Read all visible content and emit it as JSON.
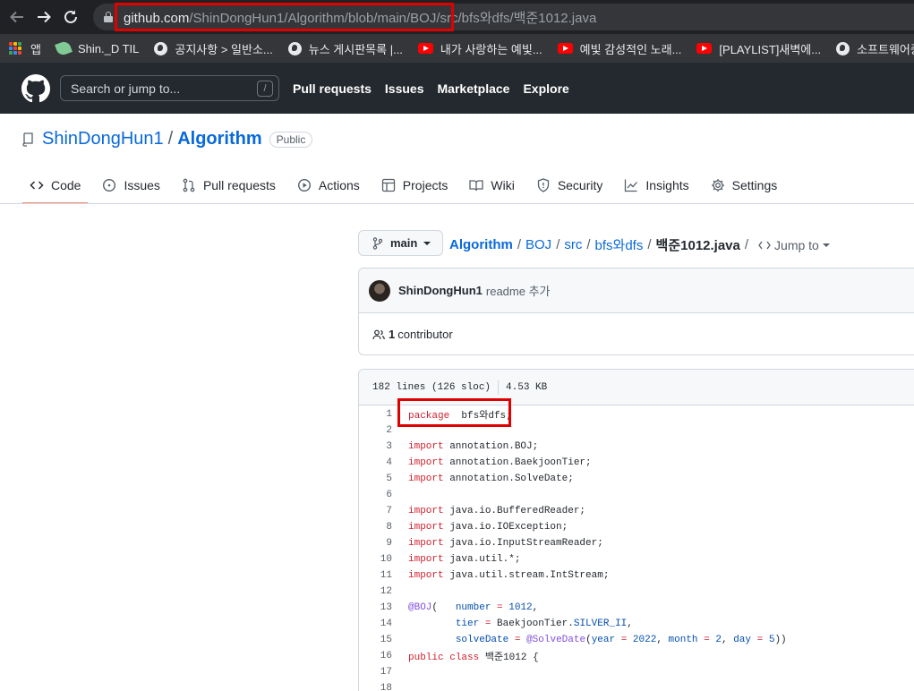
{
  "browser": {
    "url_host": "github.com",
    "url_path": "/ShinDongHun1/Algorithm/blob/main/BOJ/src/bfs와dfs/백준1012.java",
    "bookmarks": [
      {
        "label": "앱",
        "icon": "apps-grid-icon"
      },
      {
        "label": "Shin._D TIL",
        "icon": "leaf-icon"
      },
      {
        "label": "공지사항 > 일반소...",
        "icon": "globe-icon"
      },
      {
        "label": "뉴스 게시판목록 |...",
        "icon": "globe-icon"
      },
      {
        "label": "내가 사랑하는 예빛...",
        "icon": "youtube-icon"
      },
      {
        "label": "예빛 감성적인 노래...",
        "icon": "youtube-icon"
      },
      {
        "label": "[PLAYLIST]새벽에...",
        "icon": "youtube-icon"
      },
      {
        "label": "소프트웨어중심대...",
        "icon": "globe-icon"
      }
    ]
  },
  "header": {
    "search_placeholder": "Search or jump to...",
    "search_key": "/",
    "nav": [
      "Pull requests",
      "Issues",
      "Marketplace",
      "Explore"
    ]
  },
  "repo": {
    "owner": "ShinDongHun1",
    "separator": "/",
    "name": "Algorithm",
    "visibility": "Public",
    "tabs": [
      {
        "label": "Code",
        "icon": "code-icon",
        "selected": true
      },
      {
        "label": "Issues",
        "icon": "issue-icon"
      },
      {
        "label": "Pull requests",
        "icon": "pull-request-icon"
      },
      {
        "label": "Actions",
        "icon": "play-icon"
      },
      {
        "label": "Projects",
        "icon": "table-icon"
      },
      {
        "label": "Wiki",
        "icon": "book-icon"
      },
      {
        "label": "Security",
        "icon": "shield-icon"
      },
      {
        "label": "Insights",
        "icon": "graph-icon"
      },
      {
        "label": "Settings",
        "icon": "gear-icon"
      }
    ]
  },
  "file_nav": {
    "branch": "main",
    "path": [
      "Algorithm",
      "BOJ",
      "src",
      "bfs와dfs"
    ],
    "separator": "/",
    "filename": "백준1012.java",
    "jump_label": "Jump to"
  },
  "commit": {
    "author": "ShinDongHun1",
    "message": "readme 추가",
    "contributor_count": "1",
    "contributor_label": "contributor"
  },
  "file_info": {
    "lines": "182 lines (126 sloc)",
    "size": "4.53 KB"
  },
  "code_lines": [
    {
      "n": "1",
      "tokens": [
        [
          "kw",
          "package"
        ],
        [
          "",
          "  bfs와dfs;"
        ]
      ]
    },
    {
      "n": "2",
      "tokens": []
    },
    {
      "n": "3",
      "tokens": [
        [
          "kw",
          "import"
        ],
        [
          "",
          " annotation.BOJ;"
        ]
      ]
    },
    {
      "n": "4",
      "tokens": [
        [
          "kw",
          "import"
        ],
        [
          "",
          " annotation.BaekjoonTier;"
        ]
      ]
    },
    {
      "n": "5",
      "tokens": [
        [
          "kw",
          "import"
        ],
        [
          "",
          " annotation.SolveDate;"
        ]
      ]
    },
    {
      "n": "6",
      "tokens": []
    },
    {
      "n": "7",
      "tokens": [
        [
          "kw",
          "import"
        ],
        [
          "",
          " java.io.BufferedReader;"
        ]
      ]
    },
    {
      "n": "8",
      "tokens": [
        [
          "kw",
          "import"
        ],
        [
          "",
          " java.io.IOException;"
        ]
      ]
    },
    {
      "n": "9",
      "tokens": [
        [
          "kw",
          "import"
        ],
        [
          "",
          " java.io.InputStreamReader;"
        ]
      ]
    },
    {
      "n": "10",
      "tokens": [
        [
          "kw",
          "import"
        ],
        [
          "",
          " java.util.*;"
        ]
      ]
    },
    {
      "n": "11",
      "tokens": [
        [
          "kw",
          "import"
        ],
        [
          "",
          " java.util.stream.IntStream;"
        ]
      ]
    },
    {
      "n": "12",
      "tokens": []
    },
    {
      "n": "13",
      "tokens": [
        [
          "ann",
          "@BOJ"
        ],
        [
          "",
          "(   "
        ],
        [
          "const",
          "number"
        ],
        [
          "",
          " "
        ],
        [
          "kw",
          "="
        ],
        [
          "",
          " "
        ],
        [
          "const",
          "1012"
        ],
        [
          "",
          ","
        ]
      ]
    },
    {
      "n": "14",
      "tokens": [
        [
          "",
          "        "
        ],
        [
          "const",
          "tier"
        ],
        [
          "",
          " "
        ],
        [
          "kw",
          "="
        ],
        [
          "",
          " BaekjoonTier."
        ],
        [
          "const",
          "SILVER_II"
        ],
        [
          "",
          ","
        ]
      ]
    },
    {
      "n": "15",
      "tokens": [
        [
          "",
          "        "
        ],
        [
          "const",
          "solveDate"
        ],
        [
          "",
          " "
        ],
        [
          "kw",
          "="
        ],
        [
          "",
          " "
        ],
        [
          "ann",
          "@SolveDate"
        ],
        [
          "",
          "("
        ],
        [
          "const",
          "year"
        ],
        [
          "",
          " "
        ],
        [
          "kw",
          "="
        ],
        [
          "",
          " "
        ],
        [
          "const",
          "2022"
        ],
        [
          "",
          ", "
        ],
        [
          "const",
          "month"
        ],
        [
          "",
          " "
        ],
        [
          "kw",
          "="
        ],
        [
          "",
          " "
        ],
        [
          "const",
          "2"
        ],
        [
          "",
          ", "
        ],
        [
          "const",
          "day"
        ],
        [
          "",
          " "
        ],
        [
          "kw",
          "="
        ],
        [
          "",
          " "
        ],
        [
          "const",
          "5"
        ],
        [
          "",
          "))"
        ]
      ]
    },
    {
      "n": "16",
      "tokens": [
        [
          "kw",
          "public"
        ],
        [
          "",
          " "
        ],
        [
          "kw",
          "class"
        ],
        [
          "",
          " 백준1012 {"
        ]
      ]
    },
    {
      "n": "17",
      "tokens": []
    },
    {
      "n": "18",
      "tokens": []
    }
  ],
  "colors": {
    "highlight": "#e00000",
    "gh_header": "#24292f",
    "link": "#0969da",
    "tab_underline": "#fd8c73"
  }
}
